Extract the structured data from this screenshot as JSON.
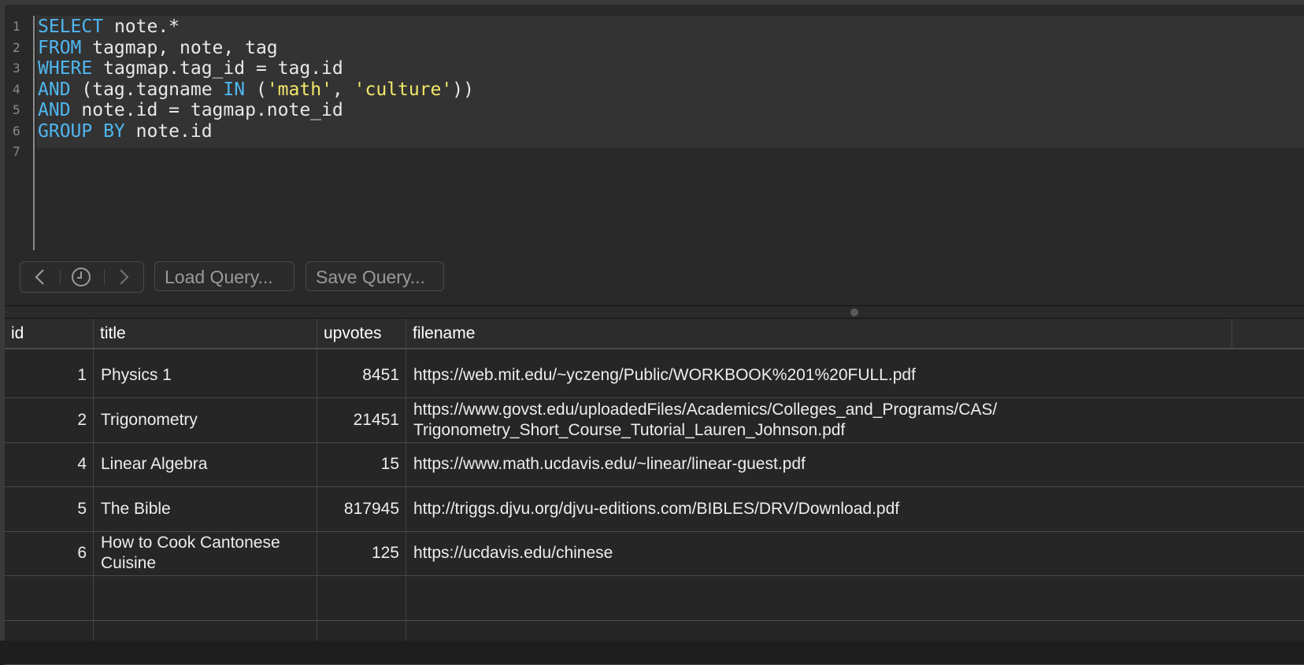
{
  "editor": {
    "lines": [
      {
        "n": "1",
        "tokens": [
          {
            "t": "SELECT",
            "k": "kw"
          },
          {
            "t": " note.*",
            "k": ""
          }
        ]
      },
      {
        "n": "2",
        "tokens": [
          {
            "t": "FROM",
            "k": "kw"
          },
          {
            "t": " tagmap, note, tag",
            "k": ""
          }
        ]
      },
      {
        "n": "3",
        "tokens": [
          {
            "t": "WHERE",
            "k": "kw"
          },
          {
            "t": " tagmap.tag_id = tag.id",
            "k": ""
          }
        ]
      },
      {
        "n": "4",
        "tokens": [
          {
            "t": "AND",
            "k": "kw"
          },
          {
            "t": " (tag.tagname ",
            "k": ""
          },
          {
            "t": "IN",
            "k": "kw"
          },
          {
            "t": " (",
            "k": ""
          },
          {
            "t": "'math'",
            "k": "str"
          },
          {
            "t": ", ",
            "k": ""
          },
          {
            "t": "'culture'",
            "k": "str"
          },
          {
            "t": "))",
            "k": ""
          }
        ]
      },
      {
        "n": "5",
        "tokens": [
          {
            "t": "AND",
            "k": "kw"
          },
          {
            "t": " note.id = tagmap.note_id",
            "k": ""
          }
        ]
      },
      {
        "n": "6",
        "tokens": [
          {
            "t": "GROUP BY",
            "k": "kw"
          },
          {
            "t": " note.id",
            "k": ""
          }
        ]
      },
      {
        "n": "7",
        "tokens": []
      }
    ]
  },
  "toolbar": {
    "load_label": "Load Query...",
    "save_label": "Save Query..."
  },
  "table": {
    "columns": [
      "id",
      "title",
      "upvotes",
      "filename"
    ],
    "rows": [
      {
        "id": "1",
        "title": "Physics 1",
        "upvotes": "8451",
        "filename": "https://web.mit.edu/~yczeng/Public/WORKBOOK%201%20FULL.pdf"
      },
      {
        "id": "2",
        "title": "Trigonometry",
        "upvotes": "21451",
        "filename": "https://www.govst.edu/uploadedFiles/Academics/Colleges_and_Programs/CAS/\nTrigonometry_Short_Course_Tutorial_Lauren_Johnson.pdf"
      },
      {
        "id": "4",
        "title": "Linear Algebra",
        "upvotes": "15",
        "filename": "https://www.math.ucdavis.edu/~linear/linear-guest.pdf"
      },
      {
        "id": "5",
        "title": "The Bible",
        "upvotes": "817945",
        "filename": "http://triggs.djvu.org/djvu-editions.com/BIBLES/DRV/Download.pdf"
      },
      {
        "id": "6",
        "title": "How to Cook Cantonese\nCuisine",
        "upvotes": "125",
        "filename": "https://ucdavis.edu/chinese"
      }
    ]
  },
  "colors": {
    "background": "#1e1e1e",
    "keyword": "#4fb6ef",
    "string": "#f2e86a",
    "text": "#e8e8e8"
  },
  "icons": [
    "chevron-left-icon",
    "history-clock-icon",
    "chevron-right-icon"
  ]
}
